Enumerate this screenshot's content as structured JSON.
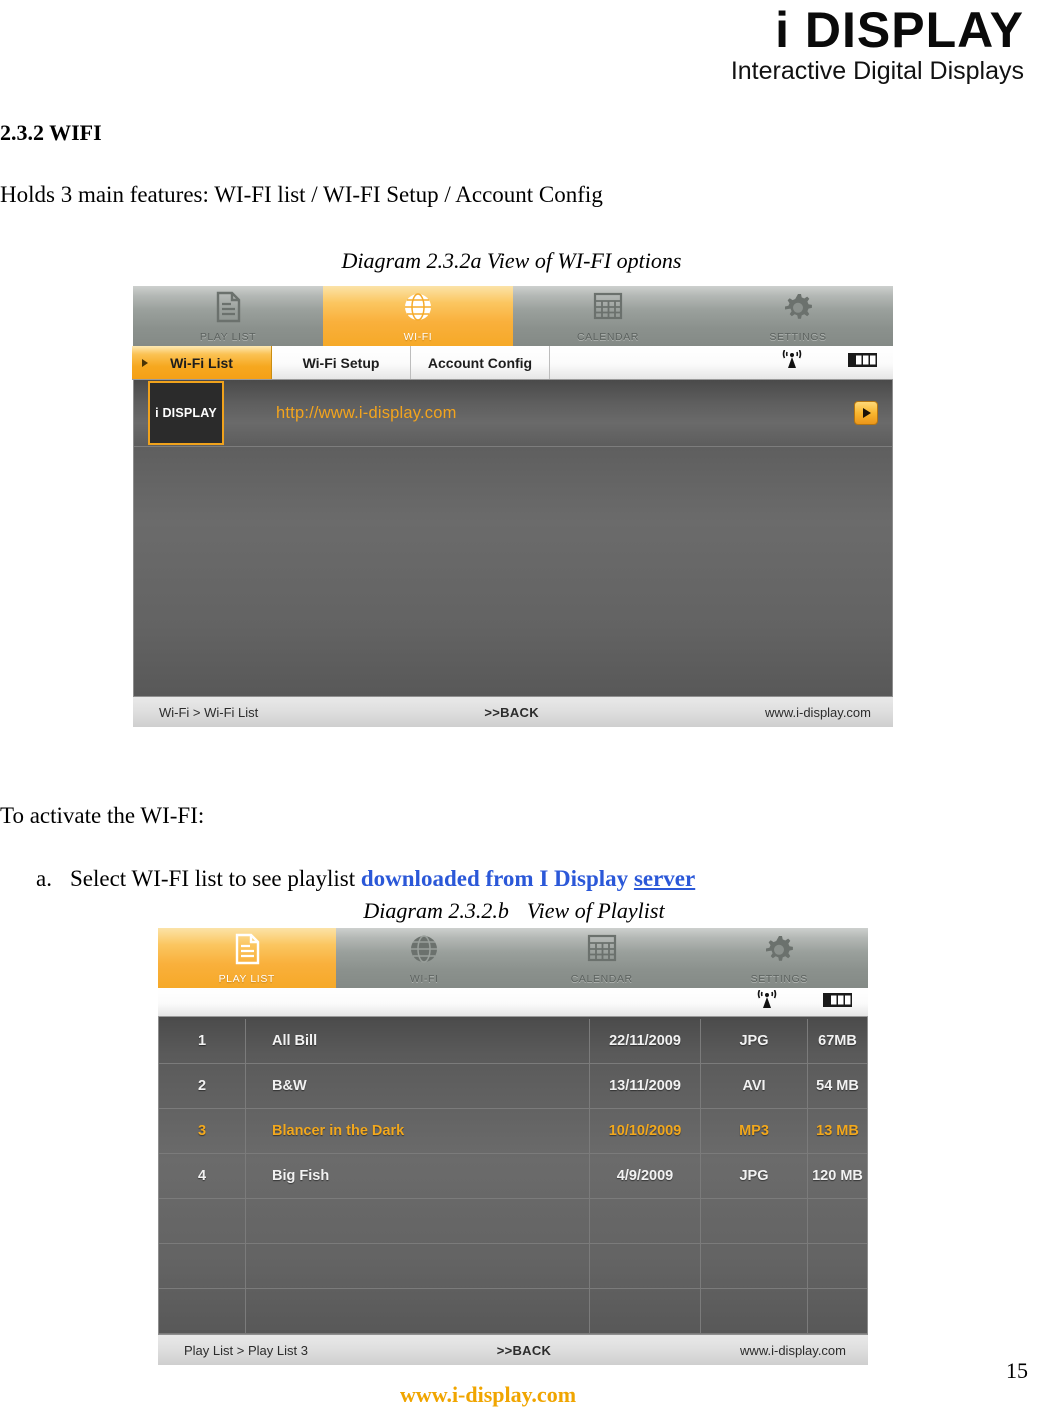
{
  "header": {
    "logo_main": "i DISPLAY",
    "logo_sub": "Interactive Digital Displays"
  },
  "document": {
    "section_heading": "2.3.2 WIFI",
    "intro": "Holds 3 main features: WI-FI list / WI-FI Setup / Account Config",
    "caption_a": "Diagram 2.3.2a View of WI-FI options",
    "activate_text": "To activate the WI-FI:",
    "list_item_marker": "a.",
    "list_item_text": "Select WI-FI list to see playlist ",
    "list_item_link": "downloaded from I Display",
    "list_item_link2": "server",
    "caption_b_1": "Diagram 2.3.2.b",
    "caption_b_2": "View of Playlist",
    "footer_page": "15",
    "footer_url": "www.i-display.com"
  },
  "screenshot_wifi": {
    "nav": [
      {
        "label": "PLAY LIST",
        "icon": "document-icon",
        "active": false
      },
      {
        "label": "WI-FI",
        "icon": "globe-icon",
        "active": true
      },
      {
        "label": "CALENDAR",
        "icon": "calendar-icon",
        "active": false
      },
      {
        "label": "SETTINGS",
        "icon": "gear-icon",
        "active": false
      }
    ],
    "subtabs": [
      {
        "label": "Wi-Fi List",
        "selected": true
      },
      {
        "label": "Wi-Fi Setup",
        "selected": false
      },
      {
        "label": "Account Config",
        "selected": false
      }
    ],
    "status_icons": [
      "signal-icon",
      "battery-icon"
    ],
    "row": {
      "thumb_label": "i DISPLAY",
      "url": "http://www.i-display.com",
      "play_button": "play-icon"
    },
    "statusbar": {
      "breadcrumb": "Wi-Fi > Wi-Fi List",
      "back": ">>BACK",
      "site": "www.i-display.com"
    }
  },
  "screenshot_playlist": {
    "nav": [
      {
        "label": "PLAY LIST",
        "icon": "document-icon",
        "active": true
      },
      {
        "label": "WI-FI",
        "icon": "globe-icon",
        "active": false
      },
      {
        "label": "CALENDAR",
        "icon": "calendar-icon",
        "active": false
      },
      {
        "label": "SETTINGS",
        "icon": "gear-icon",
        "active": false
      }
    ],
    "status_icons": [
      "signal-icon",
      "battery-icon"
    ],
    "rows": [
      {
        "idx": "1",
        "title": "All Bill",
        "date": "22/11/2009",
        "type": "JPG",
        "size": "67MB",
        "highlight": false
      },
      {
        "idx": "2",
        "title": "B&W",
        "date": "13/11/2009",
        "type": "AVI",
        "size": "54 MB",
        "highlight": false
      },
      {
        "idx": "3",
        "title": "Blancer in the Dark",
        "date": "10/10/2009",
        "type": "MP3",
        "size": "13 MB",
        "highlight": true
      },
      {
        "idx": "4",
        "title": "Big Fish",
        "date": "4/9/2009",
        "type": "JPG",
        "size": "120 MB",
        "highlight": false
      }
    ],
    "empty_row_count": 3,
    "statusbar": {
      "breadcrumb": "Play List > Play List 3",
      "back": ">>BACK",
      "site": "www.i-display.com"
    }
  },
  "colors": {
    "accent_orange": "#f5a016",
    "link_blue": "#2b58d8",
    "panel_dark": "#606060"
  }
}
